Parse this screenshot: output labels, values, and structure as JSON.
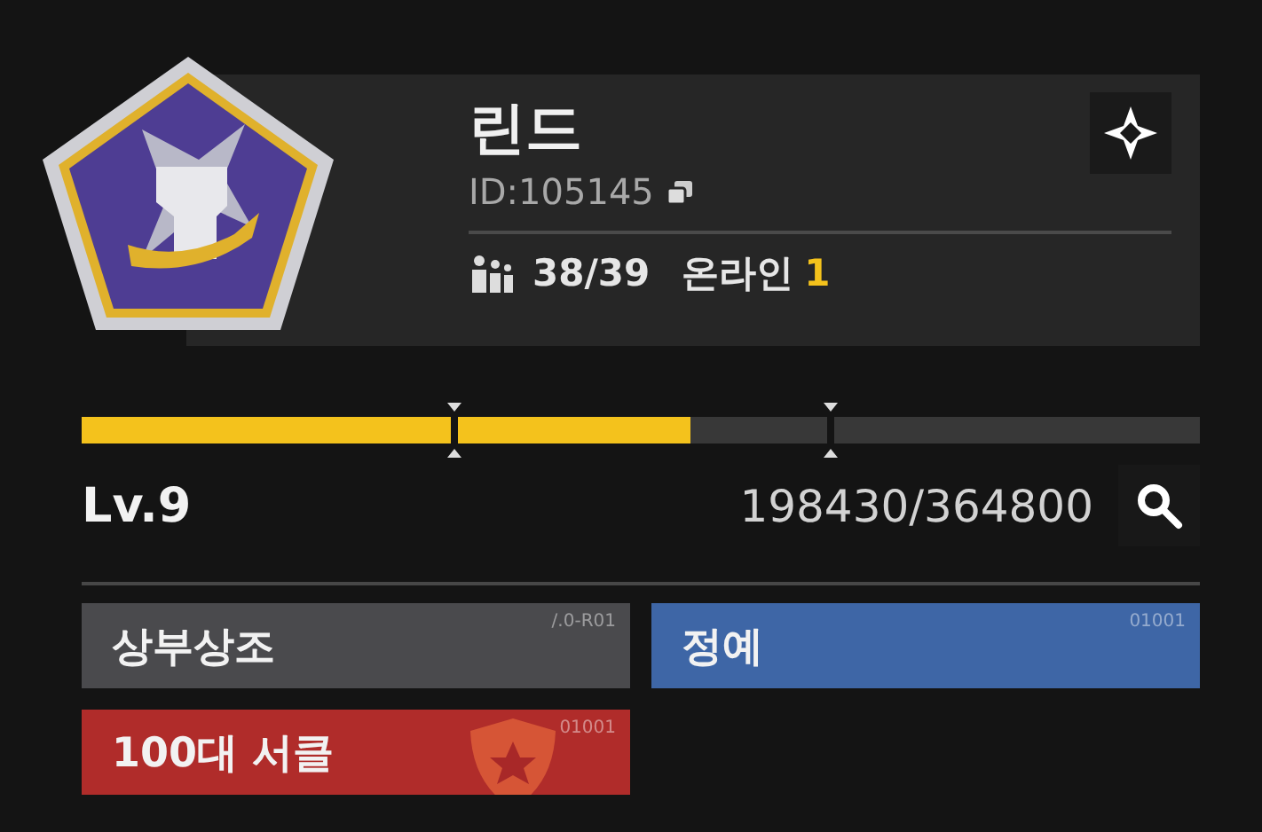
{
  "club": {
    "name": "린드",
    "id_label": "ID:",
    "id": "105145",
    "members": "38/39",
    "online_label": "온라인",
    "online": "1"
  },
  "progress": {
    "level": 0.544,
    "level_label": "Lv.9",
    "reading": "198430/364800"
  },
  "tags": [
    {
      "label": "상부상조",
      "code": "/.0-R01",
      "color": "#4a4a4d",
      "kind": "plain"
    },
    {
      "label": "정예",
      "code": "01001",
      "color": "#3e66a6",
      "kind": "plain"
    },
    {
      "label": "100대 서클",
      "code": "01001",
      "color": "#b02c2a",
      "kind": "shield"
    }
  ]
}
